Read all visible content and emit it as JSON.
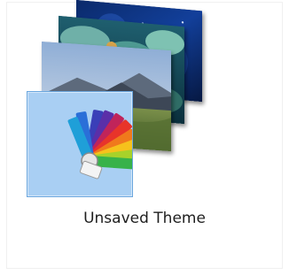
{
  "theme_item": {
    "label": "Unsaved Theme",
    "icon": "color-palette-icon",
    "selection_color": "#a9cff3",
    "selection_border": "#6aa6de"
  }
}
